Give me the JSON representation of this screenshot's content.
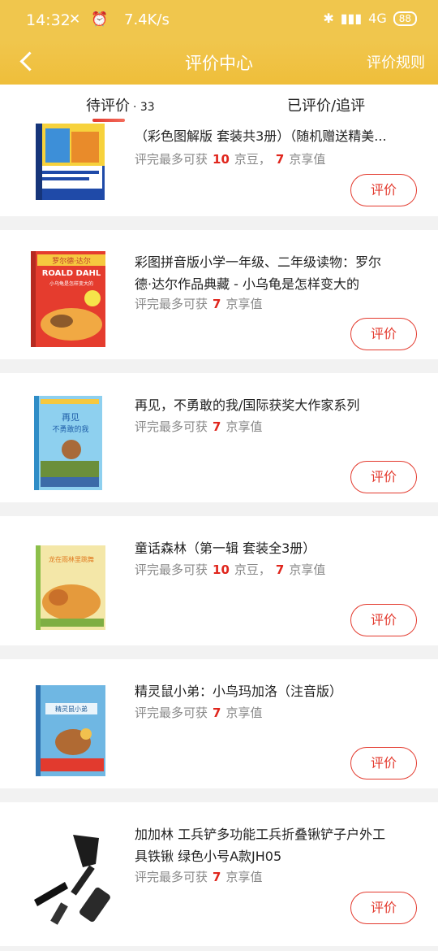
{
  "status_bar": {
    "time": "14:32",
    "speed": "7.4K/s",
    "network": "4G",
    "battery": "88"
  },
  "header": {
    "title": "评价中心",
    "rules_label": "评价规则"
  },
  "tabs": [
    {
      "label": "待评价",
      "count": "· 33"
    },
    {
      "label": "已评价/追评"
    }
  ],
  "items": [
    {
      "name_line1": "（彩色图解版 套装共3册）（随机赠送精美...",
      "name_line2": "",
      "reward_prefix": "评完最多可获",
      "beans": "10",
      "beans_unit": "京豆，",
      "value": "7",
      "value_unit": "京享值",
      "button": "评价"
    },
    {
      "name_line1": "彩图拼音版小学一年级、二年级读物：罗尔",
      "name_line2": "德·达尔作品典藏 - 小乌龟是怎样变大的",
      "reward_prefix": "评完最多可获",
      "value": "7",
      "value_unit": "京享值",
      "button": "评价",
      "cover_text": [
        "罗尔德·达尔",
        "ROALD DAHL",
        "小乌龟是怎样变大的"
      ]
    },
    {
      "name_line1": "再见，不勇敢的我/国际获奖大作家系列",
      "name_line2": "",
      "reward_prefix": "评完最多可获",
      "value": "7",
      "value_unit": "京享值",
      "button": "评价",
      "cover_text": [
        "再见",
        "不勇敢的我"
      ]
    },
    {
      "name_line1": "童话森林（第一辑 套装全3册）",
      "name_line2": "",
      "reward_prefix": "评完最多可获",
      "beans": "10",
      "beans_unit": "京豆，",
      "value": "7",
      "value_unit": "京享值",
      "button": "评价",
      "cover_text": [
        "龙在雨林里跳舞"
      ]
    },
    {
      "name_line1": "精灵鼠小弟：小鸟玛加洛（注音版）",
      "name_line2": "",
      "reward_prefix": "评完最多可获",
      "value": "7",
      "value_unit": "京享值",
      "button": "评价",
      "cover_text": [
        "精灵鼠小弟"
      ]
    },
    {
      "name_line1": "加加林 工兵铲多功能工兵折叠锹铲子户外工",
      "name_line2": "具铁锹 绿色小号A款JH05",
      "reward_prefix": "评完最多可获",
      "value": "7",
      "value_unit": "京享值",
      "button": "评价"
    }
  ],
  "colors": {
    "header": "#f0c64d",
    "accent": "#e33a2e"
  }
}
